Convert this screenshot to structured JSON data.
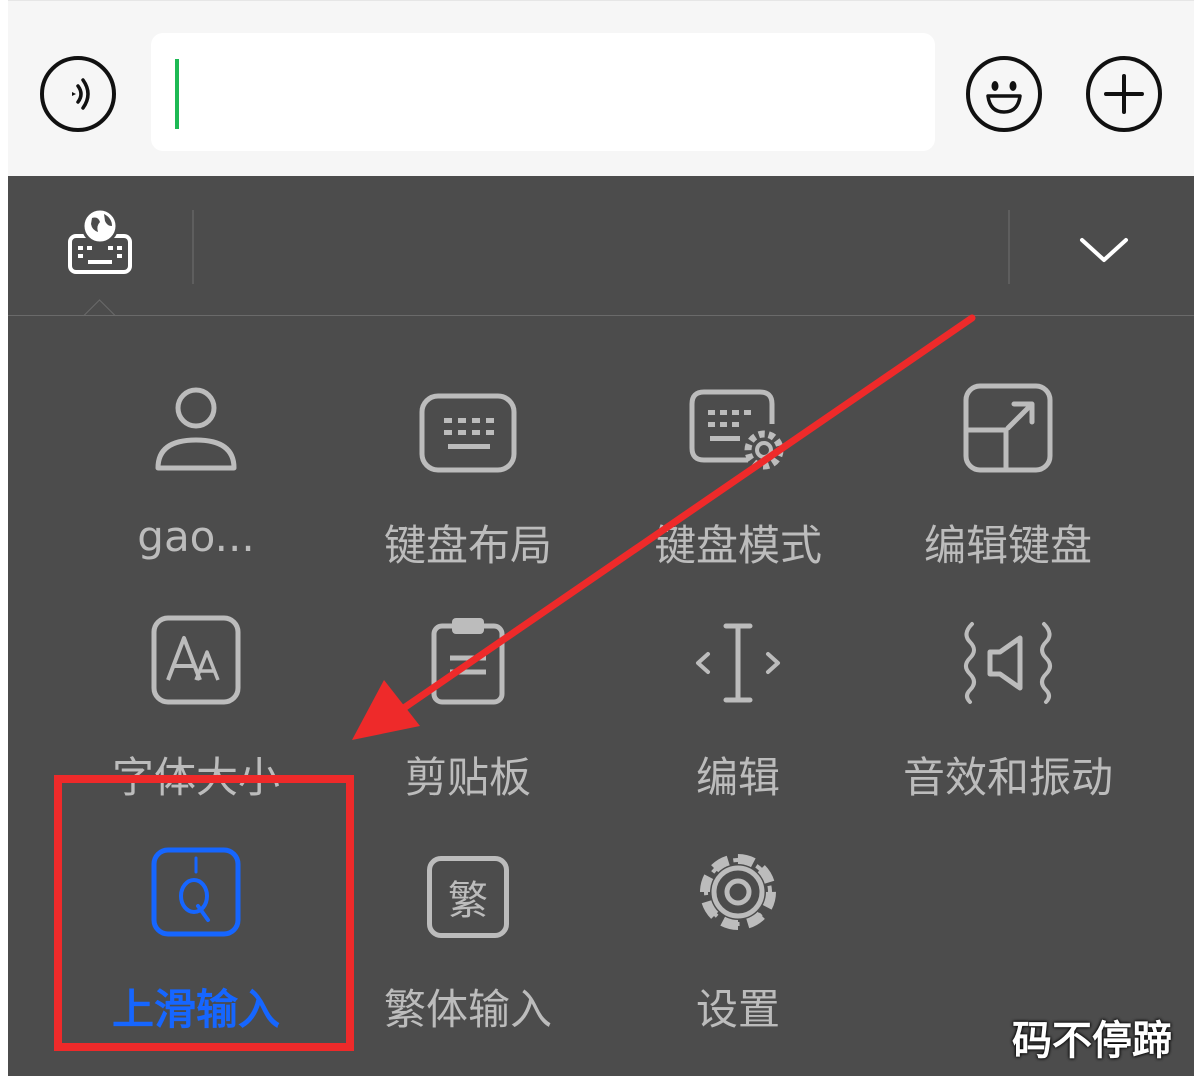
{
  "input_bar": {
    "voice_icon": "voice-wave-icon",
    "emoji_icon": "smiley-icon",
    "plus_icon": "plus-icon",
    "input_value": ""
  },
  "toolbar": {
    "left_icon": "globe-keyboard-icon",
    "right_icon": "chevron-down-icon"
  },
  "menu": {
    "items": [
      {
        "label": "gao...",
        "icon": "user-icon"
      },
      {
        "label": "键盘布局",
        "icon": "keyboard-icon"
      },
      {
        "label": "键盘模式",
        "icon": "keyboard-settings-icon"
      },
      {
        "label": "编辑键盘",
        "icon": "resize-arrow-icon"
      },
      {
        "label": "字体大小",
        "icon": "font-size-icon"
      },
      {
        "label": "剪贴板",
        "icon": "clipboard-icon"
      },
      {
        "label": "编辑",
        "icon": "text-cursor-icon"
      },
      {
        "label": "音效和振动",
        "icon": "sound-vibration-icon"
      },
      {
        "label": "上滑输入",
        "icon": "swipe-input-icon",
        "active": true
      },
      {
        "label": "繁体输入",
        "icon": "traditional-chinese-icon",
        "glyph": "繁"
      },
      {
        "label": "设置",
        "icon": "gear-icon"
      }
    ]
  },
  "colors": {
    "panel": "#4c4c4c",
    "icon": "#bcbcbc",
    "active": "#1666ff",
    "annotation": "#ee2a2a",
    "caret": "#1db954"
  },
  "watermark": "码不停蹄"
}
